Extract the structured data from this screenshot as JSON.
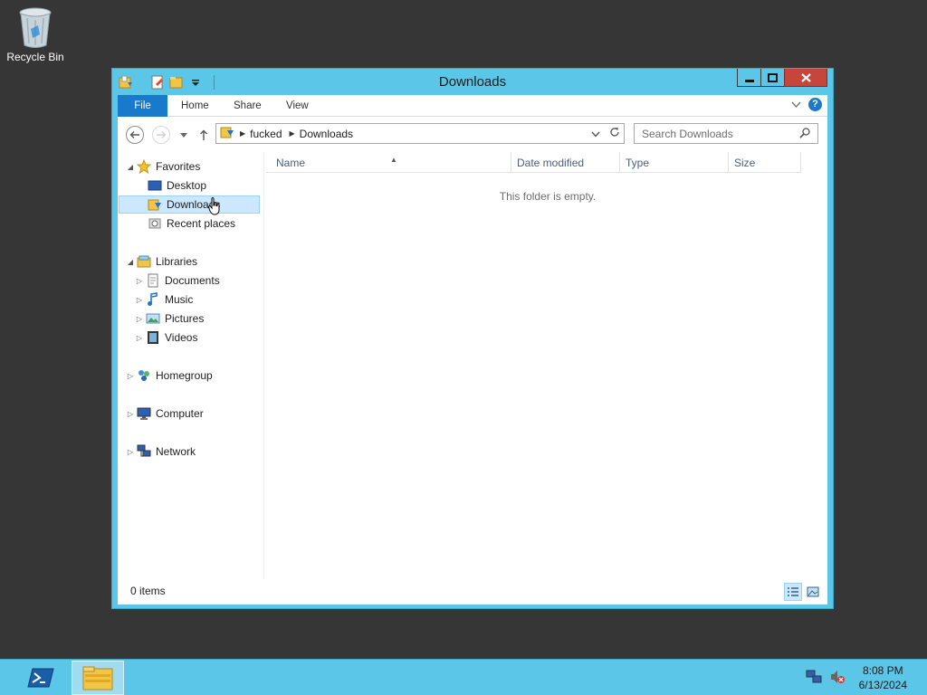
{
  "desktop": {
    "recycle_bin_label": "Recycle Bin"
  },
  "window": {
    "title": "Downloads",
    "ribbon": {
      "file_tab": "File",
      "tabs": [
        "Home",
        "Share",
        "View"
      ]
    },
    "address": {
      "crumbs": [
        "fucked",
        "Downloads"
      ]
    },
    "search_placeholder": "Search Downloads",
    "nav": {
      "favorites": "Favorites",
      "desktop": "Desktop",
      "downloads": "Downloads",
      "recent": "Recent places",
      "libraries": "Libraries",
      "documents": "Documents",
      "music": "Music",
      "pictures": "Pictures",
      "videos": "Videos",
      "homegroup": "Homegroup",
      "computer": "Computer",
      "network": "Network"
    },
    "columns": {
      "name": "Name",
      "date_modified": "Date modified",
      "type": "Type",
      "size": "Size"
    },
    "empty_message": "This folder is empty.",
    "status": "0 items"
  },
  "taskbar": {
    "time": "8:08 PM",
    "date": "6/13/2024"
  },
  "colors": {
    "window_frame": "#5bc6e8",
    "file_tab": "#1979ca",
    "close_button": "#c7463b",
    "selection": "#cce8ff",
    "desktop": "#363636"
  }
}
